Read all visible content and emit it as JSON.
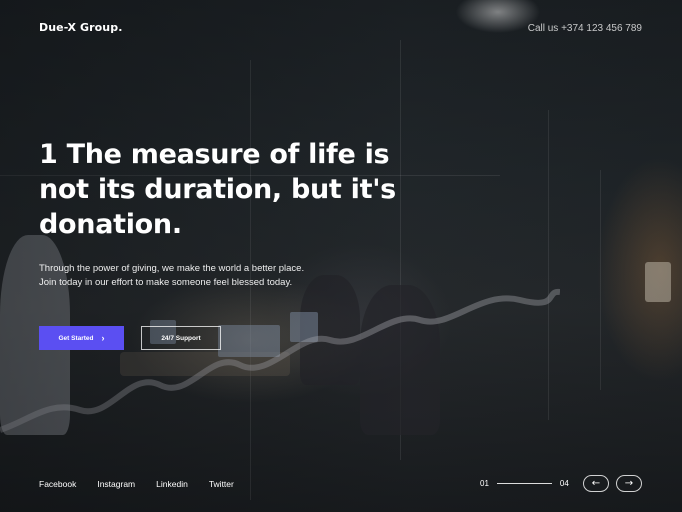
{
  "brand": "Due-X Group.",
  "contact": "Call us +374 123 456 789",
  "hero": {
    "headline": "1 The measure of life is not its duration, but it's donation.",
    "subtext": "Through the power of giving, we make the world a better place. Join today in our effort to make someone feel blessed today."
  },
  "buttons": {
    "primary_label": "Get Started",
    "secondary_label": "24/7 Support"
  },
  "social": [
    "Facebook",
    "Instagram",
    "Linkedin",
    "Twitter"
  ],
  "pager": {
    "current": "01",
    "total": "04"
  },
  "icons": {
    "primary_button": "chevron-right-icon",
    "prev": "arrow-left-icon",
    "next": "arrow-right-icon"
  },
  "colors": {
    "accent": "#5b4ff2",
    "text": "#ffffff"
  }
}
